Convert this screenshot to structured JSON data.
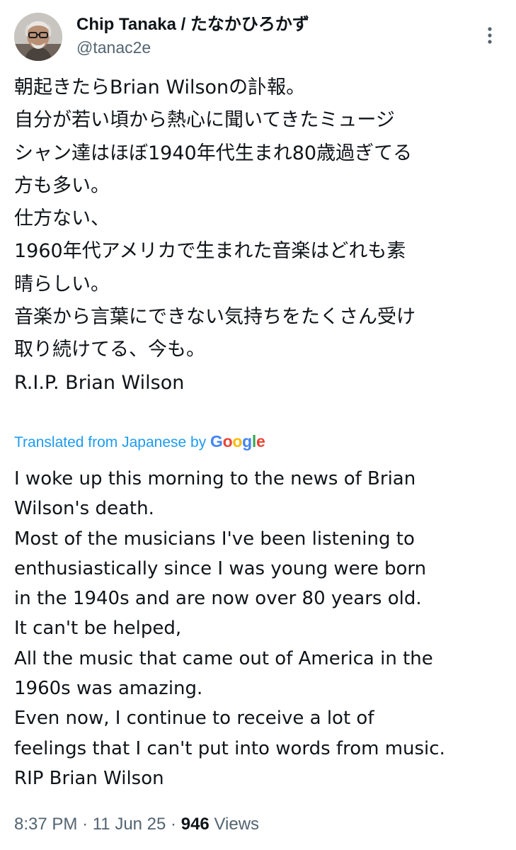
{
  "author": {
    "display_name": "Chip Tanaka / たなかひろかず",
    "handle": "@tanac2e"
  },
  "post": {
    "original_lines": [
      "朝起きたらBrian Wilsonの訃報。",
      "自分が若い頃から熱心に聞いてきたミュージ",
      "シャン達はほぼ1940年代生まれ80歳過ぎてる",
      "方も多い。",
      "仕方ない、",
      "1960年代アメリカで生まれた音楽はどれも素",
      "晴らしい。",
      "音楽から言葉にできない気持ちをたくさん受け",
      "取り続けてる、今も。",
      "R.I.P. Brian Wilson"
    ],
    "translated_from": "Translated from Japanese by",
    "translator": "Google",
    "translation_lines": [
      "I woke up this morning to the news of Brian",
      "Wilson's death.",
      "Most of the musicians I've been listening to",
      "enthusiastically since I was young were born",
      "in the 1940s and are now over 80 years old.",
      "It can't be helped,",
      "All the music that came out of America in the",
      "1960s was amazing.",
      "Even now, I continue to receive a lot of",
      "feelings that I can't put into words from music.",
      "RIP Brian Wilson"
    ]
  },
  "meta": {
    "time": "8:37 PM",
    "separator": "·",
    "date": "11 Jun 25",
    "views_count": "946",
    "views_label": "Views"
  },
  "icons": {
    "more": "more-vertical-icon",
    "avatar": "avatar"
  },
  "colors": {
    "text_primary": "#0f1419",
    "text_secondary": "#536471",
    "link": "#1d9bf0",
    "google_blue": "#4285f4",
    "google_red": "#ea4335",
    "google_yellow": "#fbbc05",
    "google_green": "#34a853"
  }
}
